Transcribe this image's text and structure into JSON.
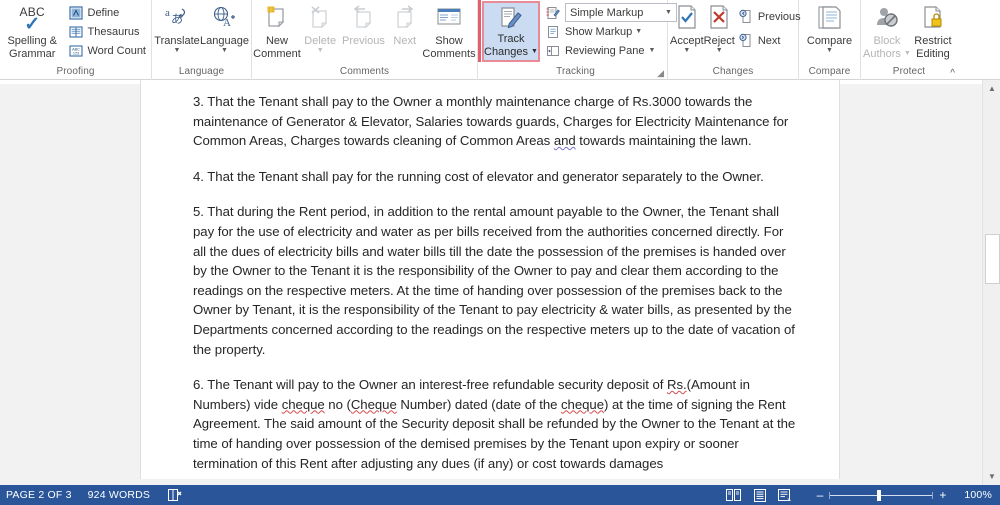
{
  "app": {
    "name": "Microsoft Word",
    "ribbon_tab": "Review"
  },
  "ribbon": {
    "groups": [
      {
        "name": "proofing",
        "label": "Proofing",
        "items": [
          {
            "name": "spelling-grammar",
            "label_line1": "Spelling &",
            "label_line2": "Grammar",
            "icon": "abc-check-icon",
            "abc": "ABC"
          },
          {
            "name": "define",
            "label": "Define",
            "icon": "define-icon"
          },
          {
            "name": "thesaurus",
            "label": "Thesaurus",
            "icon": "thesaurus-icon"
          },
          {
            "name": "word-count",
            "label": "Word Count",
            "icon": "word-count-icon"
          }
        ]
      },
      {
        "name": "language",
        "label": "Language",
        "items": [
          {
            "name": "translate",
            "label": "Translate",
            "icon": "translate-icon",
            "has_caret": true
          },
          {
            "name": "language",
            "label": "Language",
            "icon": "language-icon",
            "has_caret": true
          }
        ]
      },
      {
        "name": "comments",
        "label": "Comments",
        "items": [
          {
            "name": "new-comment",
            "label_line1": "New",
            "label_line2": "Comment",
            "icon": "new-comment-icon",
            "disabled": false
          },
          {
            "name": "delete-comment",
            "label_line1": "Delete",
            "label_line2": "",
            "icon": "delete-comment-icon",
            "disabled": true,
            "has_caret": true
          },
          {
            "name": "previous-comment",
            "label_line1": "Previous",
            "label_line2": "",
            "icon": "previous-comment-icon",
            "disabled": true
          },
          {
            "name": "next-comment",
            "label_line1": "Next",
            "label_line2": "",
            "icon": "next-comment-icon",
            "disabled": true
          },
          {
            "name": "show-comments",
            "label_line1": "Show",
            "label_line2": "Comments",
            "icon": "show-comments-icon",
            "disabled": false
          }
        ]
      },
      {
        "name": "tracking",
        "label": "Tracking",
        "highlighted": true,
        "items": [
          {
            "name": "track-changes",
            "label_line1": "Track",
            "label_line2": "Changes",
            "icon": "track-changes-icon",
            "has_caret": true,
            "selected": true
          },
          {
            "name": "display-for-review",
            "label": "Simple Markup",
            "icon": "display-for-review-icon",
            "type": "dropdown"
          },
          {
            "name": "show-markup",
            "label": "Show Markup",
            "icon": "show-markup-icon",
            "has_caret": true
          },
          {
            "name": "reviewing-pane",
            "label": "Reviewing Pane",
            "icon": "reviewing-pane-icon",
            "has_caret": true
          }
        ]
      },
      {
        "name": "changes",
        "label": "Changes",
        "items": [
          {
            "name": "accept",
            "label": "Accept",
            "icon": "accept-icon",
            "has_caret": true
          },
          {
            "name": "reject",
            "label": "Reject",
            "icon": "reject-icon",
            "has_caret": true
          },
          {
            "name": "previous-change",
            "label": "Previous",
            "icon": "previous-change-icon"
          },
          {
            "name": "next-change",
            "label": "Next",
            "icon": "next-change-icon"
          }
        ]
      },
      {
        "name": "compare",
        "label": "Compare",
        "items": [
          {
            "name": "compare",
            "label": "Compare",
            "icon": "compare-icon",
            "has_caret": true
          }
        ]
      },
      {
        "name": "protect",
        "label": "Protect",
        "items": [
          {
            "name": "block-authors",
            "label_line1": "Block",
            "label_line2": "Authors",
            "icon": "block-authors-icon",
            "disabled": true,
            "has_caret": true
          },
          {
            "name": "restrict-editing",
            "label_line1": "Restrict",
            "label_line2": "Editing",
            "icon": "restrict-editing-icon",
            "disabled": false
          }
        ]
      }
    ],
    "collapse_label": "^"
  },
  "document": {
    "paragraphs": [
      {
        "id": "clause-3",
        "runs": [
          {
            "text": "3. That the Tenant shall pay to the Owner a monthly maintenance charge of Rs.3000 towards the maintenance of Generator & Elevator, Salaries towards guards, Charges for Electricity Maintenance for Common Areas, Charges towards cleaning of Common Areas ",
            "mark": "none"
          },
          {
            "text": "and",
            "mark": "grammar"
          },
          {
            "text": " towards maintaining the lawn.",
            "mark": "none"
          }
        ]
      },
      {
        "id": "clause-4",
        "runs": [
          {
            "text": "4. That the Tenant shall pay for the running cost of elevator and generator separately to the Owner.",
            "mark": "none"
          }
        ]
      },
      {
        "id": "clause-5",
        "runs": [
          {
            "text": "5. That during the Rent period, in addition to the rental amount payable to the Owner, the Tenant shall pay for the use of electricity and water as per bills received from the authorities concerned directly. For all the dues of electricity bills and water bills till the date the possession of the premises is handed over by the Owner to the Tenant it is the responsibility of the Owner to pay and clear them according to the readings on the respective meters. At the time of handing over possession of the premises back to the Owner by Tenant, it is the responsibility of the Tenant to pay electricity & water bills, as presented by the Departments concerned according to the readings on the respective meters up to the date of vacation of the property.",
            "mark": "none"
          }
        ]
      },
      {
        "id": "clause-6",
        "runs": [
          {
            "text": "6. The Tenant will pay to the Owner an interest-free refundable security deposit of ",
            "mark": "none"
          },
          {
            "text": "Rs.",
            "mark": "spelling"
          },
          {
            "text": "(Amount in Numbers) vide ",
            "mark": "none"
          },
          {
            "text": "cheque",
            "mark": "spelling"
          },
          {
            "text": " no (",
            "mark": "none"
          },
          {
            "text": "Cheque",
            "mark": "spelling"
          },
          {
            "text": " Number) dated (date of the ",
            "mark": "none"
          },
          {
            "text": "cheque",
            "mark": "spelling"
          },
          {
            "text": ") at the time of signing the Rent Agreement. The said amount of the Security deposit shall be refunded by the Owner to the Tenant at the time of handing over possession of the demised premises by the Tenant upon expiry or sooner termination of this Rent after adjusting any dues (if any) or cost towards damages",
            "mark": "none"
          }
        ]
      }
    ]
  },
  "scrollbar": {
    "up_arrow": "▲",
    "down_arrow": "▼"
  },
  "statusbar": {
    "page_info": "PAGE 2 OF 3",
    "word_count": "924 WORDS",
    "proofing_icon": "proofing-status-icon",
    "views": [
      {
        "name": "read-mode-view",
        "icon": "read-mode-icon"
      },
      {
        "name": "print-layout-view",
        "icon": "print-layout-icon"
      },
      {
        "name": "web-layout-view",
        "icon": "web-layout-icon"
      }
    ],
    "zoom_out": "–",
    "zoom_in": "+",
    "zoom_level": "100%"
  },
  "colors": {
    "accent_blue": "#2a5699",
    "track_highlight_border": "#e98b96",
    "track_highlight_fill": "#cbdcf2",
    "spelling_underline": "#d64b4b",
    "grammar_underline": "#7a74c8",
    "ribbon_label": "#666666"
  }
}
